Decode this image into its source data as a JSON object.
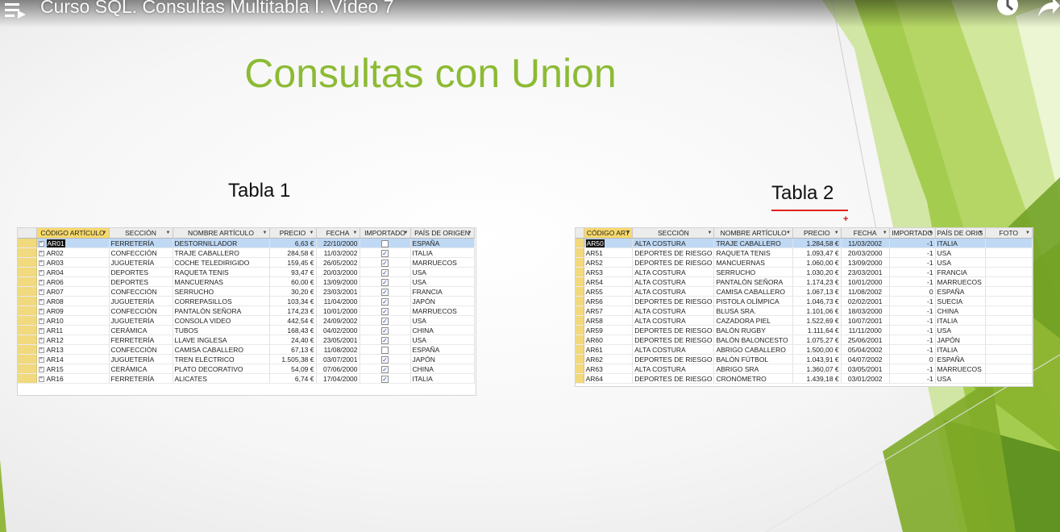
{
  "video": {
    "title": "Curso SQL. Consultas Multitabla I. Vídeo 7",
    "icons": [
      "playlist-icon",
      "clock-icon",
      "share-icon"
    ]
  },
  "slide": {
    "title": "Consultas con Union",
    "title_color": "#8cbb34",
    "accent_color": "#8cbb34",
    "table1_label": "Tabla 1",
    "table2_label": "Tabla 2"
  },
  "table1": {
    "headers": [
      "CÓDIGO ARTÍCULO",
      "SECCIÓN",
      "NOMBRE ARTÍCULO",
      "PRECIO",
      "FECHA",
      "IMPORTADO",
      "PAÍS DE ORIGEN"
    ],
    "rows": [
      {
        "codigo": "AR01",
        "seccion": "FERRETERÍA",
        "nombre": "DESTORNILLADOR",
        "precio": "6,63 €",
        "fecha": "22/10/2000",
        "importado": false,
        "pais": "ESPAÑA"
      },
      {
        "codigo": "AR02",
        "seccion": "CONFECCIÓN",
        "nombre": "TRAJE CABALLERO",
        "precio": "284,58 €",
        "fecha": "11/03/2002",
        "importado": true,
        "pais": "ITALIA"
      },
      {
        "codigo": "AR03",
        "seccion": "JUGUETERÍA",
        "nombre": "COCHE TELEDIRIGIDO",
        "precio": "159,45 €",
        "fecha": "26/05/2002",
        "importado": true,
        "pais": "MARRUECOS"
      },
      {
        "codigo": "AR04",
        "seccion": "DEPORTES",
        "nombre": "RAQUETA TENIS",
        "precio": "93,47 €",
        "fecha": "20/03/2000",
        "importado": true,
        "pais": "USA"
      },
      {
        "codigo": "AR06",
        "seccion": "DEPORTES",
        "nombre": "MANCUERNAS",
        "precio": "60,00 €",
        "fecha": "13/09/2000",
        "importado": true,
        "pais": "USA"
      },
      {
        "codigo": "AR07",
        "seccion": "CONFECCIÓN",
        "nombre": "SERRUCHO",
        "precio": "30,20 €",
        "fecha": "23/03/2001",
        "importado": true,
        "pais": "FRANCIA"
      },
      {
        "codigo": "AR08",
        "seccion": "JUGUETERÍA",
        "nombre": "CORREPASILLOS",
        "precio": "103,34 €",
        "fecha": "11/04/2000",
        "importado": true,
        "pais": "JAPÓN"
      },
      {
        "codigo": "AR09",
        "seccion": "CONFECCIÓN",
        "nombre": "PANTALÓN SEÑORA",
        "precio": "174,23 €",
        "fecha": "10/01/2000",
        "importado": true,
        "pais": "MARRUECOS"
      },
      {
        "codigo": "AR10",
        "seccion": "JUGUETERÍA",
        "nombre": "CONSOLA VIDEO",
        "precio": "442,54 €",
        "fecha": "24/09/2002",
        "importado": true,
        "pais": "USA"
      },
      {
        "codigo": "AR11",
        "seccion": "CERÁMICA",
        "nombre": "TUBOS",
        "precio": "168,43 €",
        "fecha": "04/02/2000",
        "importado": true,
        "pais": "CHINA"
      },
      {
        "codigo": "AR12",
        "seccion": "FERRETERÍA",
        "nombre": "LLAVE INGLESA",
        "precio": "24,40 €",
        "fecha": "23/05/2001",
        "importado": true,
        "pais": "USA"
      },
      {
        "codigo": "AR13",
        "seccion": "CONFECCIÓN",
        "nombre": "CAMISA CABALLERO",
        "precio": "67,13 €",
        "fecha": "11/08/2002",
        "importado": false,
        "pais": "ESPAÑA"
      },
      {
        "codigo": "AR14",
        "seccion": "JUGUETERÍA",
        "nombre": "TREN ELÉCTRICO",
        "precio": "1.505,38 €",
        "fecha": "03/07/2001",
        "importado": true,
        "pais": "JAPÓN"
      },
      {
        "codigo": "AR15",
        "seccion": "CERÁMICA",
        "nombre": "PLATO DECORATIVO",
        "precio": "54,09 €",
        "fecha": "07/06/2000",
        "importado": true,
        "pais": "CHINA"
      },
      {
        "codigo": "AR16",
        "seccion": "FERRETERÍA",
        "nombre": "ALICATES",
        "precio": "6,74 €",
        "fecha": "17/04/2000",
        "importado": true,
        "pais": "ITALIA"
      }
    ]
  },
  "table2": {
    "headers": [
      "CÓDIGO ART",
      "SECCIÓN",
      "NOMBRE ARTÍCULO",
      "PRECIO",
      "FECHA",
      "IMPORTADO",
      "PAÍS DE ORIG",
      "FOTO"
    ],
    "rows": [
      {
        "codigo": "AR50",
        "seccion": "ALTA COSTURA",
        "nombre": "TRAJE CABALLERO",
        "precio": "1.284,58 €",
        "fecha": "11/03/2002",
        "importado": "-1",
        "pais": "ITALIA"
      },
      {
        "codigo": "AR51",
        "seccion": "DEPORTES DE RIESGO",
        "nombre": "RAQUETA TENIS",
        "precio": "1.093,47 €",
        "fecha": "20/03/2000",
        "importado": "-1",
        "pais": "USA"
      },
      {
        "codigo": "AR52",
        "seccion": "DEPORTES DE RIESGO",
        "nombre": "MANCUERNAS",
        "precio": "1.060,00 €",
        "fecha": "13/09/2000",
        "importado": "-1",
        "pais": "USA"
      },
      {
        "codigo": "AR53",
        "seccion": "ALTA COSTURA",
        "nombre": "SERRUCHO",
        "precio": "1.030,20 €",
        "fecha": "23/03/2001",
        "importado": "-1",
        "pais": "FRANCIA"
      },
      {
        "codigo": "AR54",
        "seccion": "ALTA COSTURA",
        "nombre": "PANTALÓN SEÑORA",
        "precio": "1.174,23 €",
        "fecha": "10/01/2000",
        "importado": "-1",
        "pais": "MARRUECOS"
      },
      {
        "codigo": "AR55",
        "seccion": "ALTA COSTURA",
        "nombre": "CAMISA CABALLERO",
        "precio": "1.067,13 €",
        "fecha": "11/08/2002",
        "importado": "0",
        "pais": "ESPAÑA"
      },
      {
        "codigo": "AR56",
        "seccion": "DEPORTES DE RIESGO",
        "nombre": "PISTOLA OLÍMPICA",
        "precio": "1.046,73 €",
        "fecha": "02/02/2001",
        "importado": "-1",
        "pais": "SUECIA"
      },
      {
        "codigo": "AR57",
        "seccion": "ALTA COSTURA",
        "nombre": "BLUSA SRA.",
        "precio": "1.101,06 €",
        "fecha": "18/03/2000",
        "importado": "-1",
        "pais": "CHINA"
      },
      {
        "codigo": "AR58",
        "seccion": "ALTA COSTURA",
        "nombre": "CAZADORA PIEL",
        "precio": "1.522,69 €",
        "fecha": "10/07/2001",
        "importado": "-1",
        "pais": "ITALIA"
      },
      {
        "codigo": "AR59",
        "seccion": "DEPORTES DE RIESGO",
        "nombre": "BALÓN RUGBY",
        "precio": "1.111,64 €",
        "fecha": "11/11/2000",
        "importado": "-1",
        "pais": "USA"
      },
      {
        "codigo": "AR60",
        "seccion": "DEPORTES DE RIESGO",
        "nombre": "BALÓN BALONCESTO",
        "precio": "1.075,27 €",
        "fecha": "25/06/2001",
        "importado": "-1",
        "pais": "JAPÓN"
      },
      {
        "codigo": "AR61",
        "seccion": "ALTA COSTURA",
        "nombre": "ABRIGO CABALLERO",
        "precio": "1.500,00 €",
        "fecha": "05/04/2002",
        "importado": "-1",
        "pais": "ITALIA"
      },
      {
        "codigo": "AR62",
        "seccion": "DEPORTES DE RIESGO",
        "nombre": "BALÓN FÚTBOL",
        "precio": "1.043,91 €",
        "fecha": "04/07/2002",
        "importado": "0",
        "pais": "ESPAÑA"
      },
      {
        "codigo": "AR63",
        "seccion": "ALTA COSTURA",
        "nombre": "ABRIGO SRA",
        "precio": "1.360,07 €",
        "fecha": "03/05/2001",
        "importado": "-1",
        "pais": "MARRUECOS"
      },
      {
        "codigo": "AR64",
        "seccion": "DEPORTES DE RIESGO",
        "nombre": "CRONÓMETRO",
        "precio": "1.439,18 €",
        "fecha": "03/01/2002",
        "importado": "-1",
        "pais": "USA"
      }
    ]
  }
}
